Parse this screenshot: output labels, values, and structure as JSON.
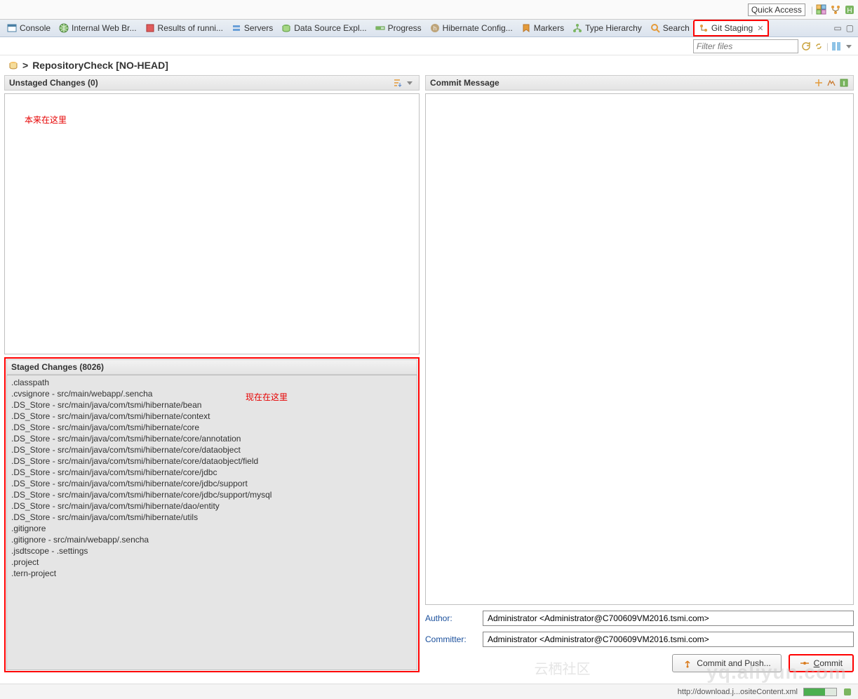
{
  "top": {
    "quick_access": "Quick Access"
  },
  "tabs": [
    {
      "label": "Console",
      "icon": "console-icon"
    },
    {
      "label": "Internal Web Br...",
      "icon": "globe-icon"
    },
    {
      "label": "Results of runni...",
      "icon": "results-icon"
    },
    {
      "label": "Servers",
      "icon": "servers-icon"
    },
    {
      "label": "Data Source Expl...",
      "icon": "datasource-icon"
    },
    {
      "label": "Progress",
      "icon": "progress-icon"
    },
    {
      "label": "Hibernate Config...",
      "icon": "hibernate-icon"
    },
    {
      "label": "Markers",
      "icon": "markers-icon"
    },
    {
      "label": "Type Hierarchy",
      "icon": "type-hierarchy-icon"
    },
    {
      "label": "Search",
      "icon": "search-icon"
    }
  ],
  "active_tab": {
    "label": "Git Staging",
    "icon": "git-icon"
  },
  "filter_placeholder": "Filter files",
  "repo_header": {
    "prefix": ">",
    "name": "RepositoryCheck [NO-HEAD]"
  },
  "left": {
    "unstaged_title": "Unstaged Changes (0)",
    "unstaged_annotation": "本来在这里",
    "staged_title": "Staged Changes (8026)",
    "staged_annotation": "现在在这里",
    "staged_files": [
      ".classpath",
      ".cvsignore - src/main/webapp/.sencha",
      ".DS_Store - src/main/java/com/tsmi/hibernate/bean",
      ".DS_Store - src/main/java/com/tsmi/hibernate/context",
      ".DS_Store - src/main/java/com/tsmi/hibernate/core",
      ".DS_Store - src/main/java/com/tsmi/hibernate/core/annotation",
      ".DS_Store - src/main/java/com/tsmi/hibernate/core/dataobject",
      ".DS_Store - src/main/java/com/tsmi/hibernate/core/dataobject/field",
      ".DS_Store - src/main/java/com/tsmi/hibernate/core/jdbc",
      ".DS_Store - src/main/java/com/tsmi/hibernate/core/jdbc/support",
      ".DS_Store - src/main/java/com/tsmi/hibernate/core/jdbc/support/mysql",
      ".DS_Store - src/main/java/com/tsmi/hibernate/dao/entity",
      ".DS_Store - src/main/java/com/tsmi/hibernate/utils",
      ".gitignore",
      ".gitignore - src/main/webapp/.sencha",
      ".jsdtscope - .settings",
      ".project",
      ".tern-project"
    ]
  },
  "right": {
    "commit_msg_title": "Commit Message",
    "author_label": "Author:",
    "committer_label": "Committer:",
    "author_value": "Administrator <Administrator@C700609VM2016.tsmi.com>",
    "committer_value": "Administrator <Administrator@C700609VM2016.tsmi.com>",
    "commit_push_btn": "Commit and Push...",
    "commit_btn": "Commit"
  },
  "status": {
    "url": "http://download.j...ositeContent.xml"
  },
  "watermark1": "yq.aliyun.com",
  "watermark2": "云栖社区"
}
